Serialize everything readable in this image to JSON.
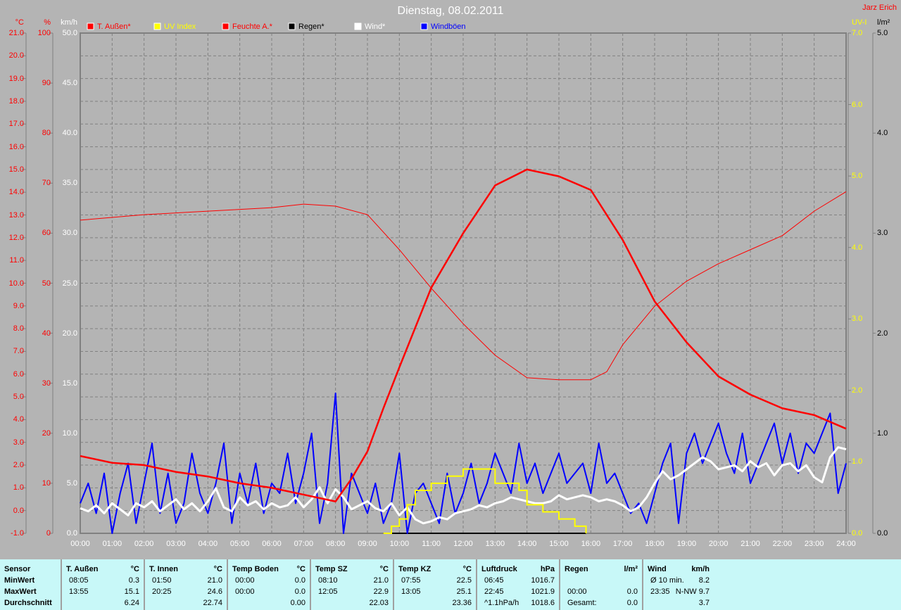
{
  "title": "Dienstag, 08.02.2011",
  "author": "Jarz Erich",
  "chart_data": {
    "type": "line",
    "title": "Dienstag, 08.02.2011",
    "legend": [
      {
        "name": "T. Außen*",
        "color": "#ff0000"
      },
      {
        "name": "UV Index",
        "color": "#ffff00"
      },
      {
        "name": "Feuchte A.*",
        "color": "#ff0000"
      },
      {
        "name": "Regen*",
        "color": "#000000"
      },
      {
        "name": "Wind*",
        "color": "#ffffff"
      },
      {
        "name": "Windböen",
        "color": "#0000ff"
      }
    ],
    "axes": {
      "temp": {
        "unit": "°C",
        "range": [
          -1,
          21
        ],
        "ticks": [
          "-1.0",
          "0.0",
          "1.0",
          "2.0",
          "3.0",
          "4.0",
          "5.0",
          "6.0",
          "7.0",
          "8.0",
          "9.0",
          "10.0",
          "11.0",
          "12.0",
          "13.0",
          "14.0",
          "15.0",
          "16.0",
          "17.0",
          "18.0",
          "19.0",
          "20.0",
          "21.0"
        ]
      },
      "hum": {
        "unit": "%",
        "range": [
          0,
          100
        ],
        "ticks": [
          "0",
          "10",
          "20",
          "30",
          "40",
          "50",
          "60",
          "70",
          "80",
          "90",
          "100"
        ]
      },
      "wind": {
        "unit": "km/h",
        "range": [
          0,
          50
        ],
        "ticks": [
          "0.0",
          "5.0",
          "10.0",
          "15.0",
          "20.0",
          "25.0",
          "30.0",
          "35.0",
          "40.0",
          "45.0",
          "50.0"
        ]
      },
      "uv": {
        "unit": "UV-I",
        "range": [
          0,
          7
        ],
        "ticks": [
          "0.0",
          "1.0",
          "2.0",
          "3.0",
          "4.0",
          "5.0",
          "6.0",
          "7.0"
        ]
      },
      "rain": {
        "unit": "l/m²",
        "range": [
          0,
          5
        ],
        "ticks": [
          "0.0",
          "1.0",
          "2.0",
          "3.0",
          "4.0",
          "5.0"
        ]
      },
      "x": {
        "range": [
          0,
          24
        ],
        "ticks": [
          "00:00",
          "01:00",
          "02:00",
          "03:00",
          "04:00",
          "05:00",
          "06:00",
          "07:00",
          "08:00",
          "09:00",
          "10:00",
          "11:00",
          "12:00",
          "13:00",
          "14:00",
          "15:00",
          "16:00",
          "17:00",
          "18:00",
          "19:00",
          "20:00",
          "21:00",
          "22:00",
          "23:00",
          "24:00"
        ]
      }
    },
    "series": {
      "temp_x": [
        0,
        1,
        2,
        3,
        4,
        5,
        6,
        7,
        8,
        8.5,
        9,
        9.5,
        10,
        11,
        12,
        13,
        14,
        15,
        16,
        17,
        18,
        19,
        20,
        21,
        22,
        23,
        24
      ],
      "temp": [
        2.4,
        2.1,
        2.0,
        1.7,
        1.5,
        1.2,
        1.0,
        0.7,
        0.4,
        1.4,
        2.6,
        4.5,
        6.3,
        9.8,
        12.2,
        14.3,
        15.0,
        14.7,
        14.1,
        11.9,
        9.2,
        7.4,
        5.9,
        5.1,
        4.5,
        4.2,
        3.6
      ],
      "hum_x": [
        0,
        2,
        4,
        6,
        7,
        8,
        9,
        10,
        11,
        12,
        13,
        14,
        15,
        16,
        16.5,
        17,
        18,
        19,
        20,
        21,
        22,
        23,
        24
      ],
      "hum": [
        62.6,
        63.7,
        64.4,
        65.1,
        65.8,
        65.4,
        63.7,
        56.7,
        49,
        41.9,
        35.6,
        31.1,
        30.7,
        30.7,
        32.3,
        37.7,
        45.4,
        50.4,
        53.9,
        56.7,
        59.5,
        64.4,
        68.3
      ],
      "wind": [
        2.5,
        2.2,
        2.8,
        2,
        3,
        2.4,
        1.8,
        3,
        2.6,
        3.2,
        2.2,
        2.8,
        3.4,
        2.4,
        3,
        2.2,
        3.2,
        4.5,
        2.6,
        2.2,
        3.6,
        2.8,
        3.2,
        2.4,
        3,
        2.6,
        2.8,
        3.6,
        2.6,
        3.4,
        4.6,
        3,
        4.4,
        3.6,
        2.4,
        2.8,
        3.2,
        2.5,
        2.2,
        3,
        1.8,
        2.6,
        1.4,
        1,
        1.2,
        1.6,
        1.4,
        2,
        2.2,
        2.4,
        2.8,
        2.6,
        3,
        3.2,
        3.6,
        3.4,
        3.2,
        3,
        3,
        3.2,
        3.8,
        3.4,
        3.6,
        3.8,
        3.6,
        3.2,
        3.4,
        3.2,
        2.8,
        2.2,
        2.6,
        3.6,
        5,
        6.2,
        5.4,
        5.8,
        6.4,
        7,
        7.6,
        7.2,
        6.4,
        6.6,
        6.8,
        6.2,
        7.2,
        6.6,
        7,
        5.8,
        6.8,
        7,
        6.2,
        6.8,
        5.6,
        5.1,
        7.6,
        8.6,
        8.4
      ],
      "gust": [
        3,
        5,
        2,
        6,
        0,
        4,
        7,
        1,
        5,
        9,
        2,
        6,
        1,
        3,
        8,
        4,
        2,
        5,
        9,
        1,
        6,
        3,
        7,
        2,
        5,
        4,
        8,
        3,
        6,
        10,
        1,
        5,
        14,
        0,
        6,
        4,
        2,
        5,
        1,
        3,
        8,
        0,
        4,
        5,
        3,
        1,
        6,
        2,
        4,
        7,
        3,
        5,
        8,
        6,
        4,
        9,
        5,
        7,
        4,
        6,
        8,
        5,
        6,
        7,
        4,
        9,
        5,
        6,
        4,
        2,
        3,
        1,
        4,
        7,
        9,
        1,
        8,
        10,
        7,
        9,
        11,
        8,
        6,
        10,
        5,
        7,
        9,
        11,
        7,
        10,
        6,
        9,
        8,
        10,
        12,
        4,
        7
      ],
      "uv_x": [
        9.5,
        9.75,
        10,
        10.25,
        10.5,
        11,
        11.5,
        12,
        13,
        13.75,
        14,
        14.5,
        15,
        15.5,
        15.85
      ],
      "uv": [
        0,
        0.1,
        0.2,
        0.4,
        0.6,
        0.7,
        0.8,
        0.9,
        0.7,
        0.6,
        0.4,
        0.3,
        0.2,
        0.1,
        0
      ],
      "rain_x": [
        9.5,
        15.85
      ],
      "rain": [
        0,
        0
      ]
    }
  },
  "table": [
    {
      "head": [
        "Sensor",
        ""
      ],
      "rows": [
        [
          "MinWert",
          ""
        ],
        [
          "MaxWert",
          ""
        ],
        [
          "Durchschnitt",
          ""
        ]
      ],
      "label": true
    },
    {
      "head": [
        "T. Außen",
        "°C"
      ],
      "rows": [
        [
          "08:05",
          "0.3"
        ],
        [
          "13:55",
          "15.1"
        ],
        [
          "",
          "6.24"
        ]
      ]
    },
    {
      "head": [
        "T. Innen",
        "°C"
      ],
      "rows": [
        [
          "01:50",
          "21.0"
        ],
        [
          "20:25",
          "24.6"
        ],
        [
          "",
          "22.74"
        ]
      ]
    },
    {
      "head": [
        "Temp Boden",
        "°C"
      ],
      "rows": [
        [
          "00:00",
          "0.0"
        ],
        [
          "00:00",
          "0.0"
        ],
        [
          "",
          "0.00"
        ]
      ]
    },
    {
      "head": [
        "Temp SZ",
        "°C"
      ],
      "rows": [
        [
          "08:10",
          "21.0"
        ],
        [
          "12:05",
          "22.9"
        ],
        [
          "",
          "22.03"
        ]
      ]
    },
    {
      "head": [
        "Temp KZ",
        "°C"
      ],
      "rows": [
        [
          "07:55",
          "22.5"
        ],
        [
          "13:05",
          "25.1"
        ],
        [
          "",
          "23.36"
        ]
      ]
    },
    {
      "head": [
        "Luftdruck",
        "hPa"
      ],
      "rows": [
        [
          "06:45",
          "1016.7"
        ],
        [
          "22:45",
          "1021.9"
        ],
        [
          "^1.1hPa/h",
          "1018.6"
        ]
      ]
    },
    {
      "head": [
        "Regen",
        "l/m²"
      ],
      "rows": [
        [
          "",
          ""
        ],
        [
          "00:00",
          "0.0"
        ],
        [
          "Gesamt:",
          "0.0"
        ]
      ]
    },
    {
      "head": [
        "Wind",
        "km/h"
      ],
      "rows": [
        [
          "Ø 10 min.",
          "8.2"
        ],
        [
          "23:35",
          "N-NW 9.7"
        ],
        [
          "",
          "3.7"
        ]
      ]
    }
  ]
}
